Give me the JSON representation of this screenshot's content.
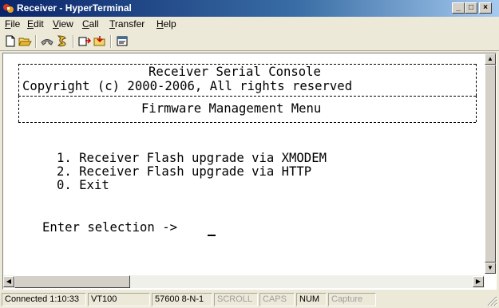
{
  "window": {
    "title": "Receiver - HyperTerminal",
    "controls": {
      "minimize": "_",
      "maximize": "□",
      "close": "×"
    }
  },
  "menu": {
    "items": [
      {
        "key": "F",
        "rest": "ile"
      },
      {
        "key": "E",
        "rest": "dit"
      },
      {
        "key": "V",
        "rest": "iew"
      },
      {
        "key": "C",
        "rest": "all"
      },
      {
        "key": "T",
        "rest": "ransfer"
      },
      {
        "key": "H",
        "rest": "elp"
      }
    ]
  },
  "toolbar": {
    "icons": [
      "new-icon",
      "open-icon",
      "disconnect-phone-icon",
      "dial-icon",
      "send-icon",
      "receive-icon",
      "properties-icon"
    ]
  },
  "terminal": {
    "header_title": "Receiver Serial Console",
    "copyright": "Copyright (c) 2000-2006, All rights reserved",
    "menu_title": "Firmware Management Menu",
    "options": [
      "1. Receiver Flash upgrade via XMODEM",
      "2. Receiver Flash upgrade via HTTP",
      "0. Exit"
    ],
    "prompt": "Enter selection -> "
  },
  "statusbar": {
    "connected": "Connected 1:10:33",
    "emulation": "VT100",
    "settings": "57600 8-N-1",
    "scroll": "SCROLL",
    "caps": "CAPS",
    "num": "NUM",
    "capture": "Capture"
  },
  "colors": {
    "titlebar_start": "#0a246a",
    "titlebar_end": "#a6caf0",
    "window_bg": "#ece9d8",
    "terminal_bg": "#ffffff",
    "terminal_fg": "#000000"
  }
}
